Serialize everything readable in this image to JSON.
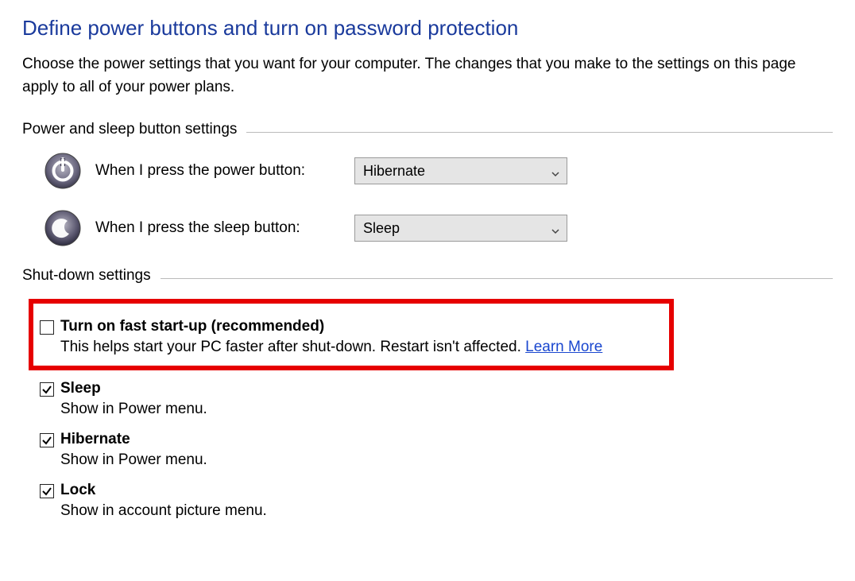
{
  "title": "Define power buttons and turn on password protection",
  "intro": "Choose the power settings that you want for your computer. The changes that you make to the settings on this page apply to all of your power plans.",
  "group1": {
    "header": "Power and sleep button settings",
    "rows": [
      {
        "label": "When I press the power button:",
        "value": "Hibernate"
      },
      {
        "label": "When I press the sleep button:",
        "value": "Sleep"
      }
    ]
  },
  "group2": {
    "header": "Shut-down settings",
    "options": [
      {
        "title": "Turn on fast start-up (recommended)",
        "desc": "This helps start your PC faster after shut-down. Restart isn't affected. ",
        "link": "Learn More",
        "checked": false,
        "highlighted": true
      },
      {
        "title": "Sleep",
        "desc": "Show in Power menu.",
        "checked": true
      },
      {
        "title": "Hibernate",
        "desc": "Show in Power menu.",
        "checked": true
      },
      {
        "title": "Lock",
        "desc": "Show in account picture menu.",
        "checked": true
      }
    ]
  }
}
